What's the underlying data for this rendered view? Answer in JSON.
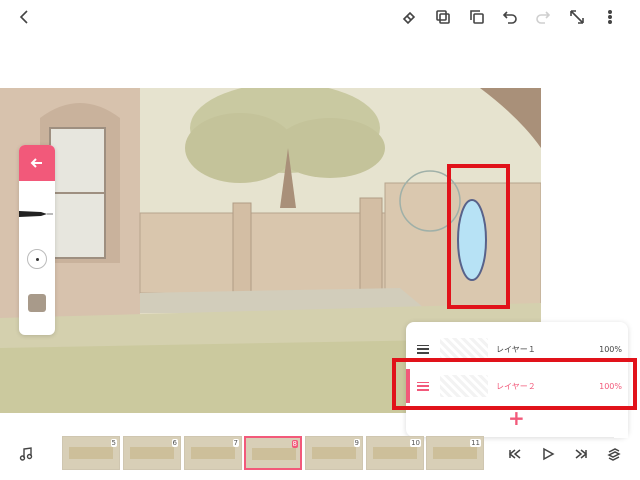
{
  "layers": [
    {
      "name": "レイヤー１",
      "opacity": "100%",
      "active": false
    },
    {
      "name": "レイヤー２",
      "opacity": "100%",
      "active": true
    }
  ],
  "layers_add_label": "+",
  "timeline": {
    "frames": [
      "5",
      "6",
      "7",
      "8",
      "9",
      "10",
      "11"
    ],
    "current_frame": "8"
  },
  "colors": {
    "accent": "#f2597a",
    "highlight": "#e1121a",
    "current_color": "#a89a8a"
  },
  "icons": {
    "topbar": [
      "back-arrow-icon",
      "eraser-icon",
      "copy-icon",
      "paste-icon",
      "undo-icon",
      "redo-icon",
      "fullscreen-icon",
      "more-vertical-icon"
    ],
    "toolpanel": [
      "arrow-left-icon",
      "pen-icon",
      "brush-size-icon",
      "color-swatch-icon"
    ],
    "bottombar": [
      "music-icon",
      "first-frame-icon",
      "play-icon",
      "last-frame-icon",
      "layers-icon"
    ]
  }
}
